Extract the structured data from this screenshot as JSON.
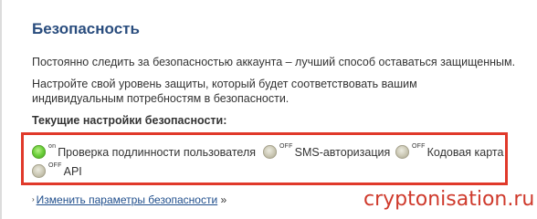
{
  "page_title": "Безопасность",
  "intro_text": "Постоянно следить за безопасностью аккаунта – лучший способ оставаться защищенным.",
  "setup_text": "Настройте свой уровень защиты, который будет соответствовать вашим индивидуальным потребностям в безопасности.",
  "current_settings_heading": "Текущие настройки безопасности:",
  "settings": [
    {
      "state": "on",
      "label": "Проверка подлинности пользователя",
      "indicator_icon": "green-status-dot-icon"
    },
    {
      "state": "OFF",
      "label": "SMS-авторизация",
      "indicator_icon": "gray-status-dot-icon"
    },
    {
      "state": "OFF",
      "label": "Кодовая карта",
      "indicator_icon": "gray-status-dot-icon"
    },
    {
      "state": "OFF",
      "label": "API",
      "indicator_icon": "gray-status-dot-icon"
    }
  ],
  "change_link": {
    "arrow": "›",
    "label": "Изменить параметры безопасности",
    "suffix": "»"
  },
  "watermark": "cryptonisation.ru",
  "colors": {
    "title": "#2a4d7e",
    "highlight_border": "#e0392a",
    "link": "#1f4e8c",
    "watermark": "#cf3a2c",
    "status_on": "#6bcf3a",
    "status_off": "#c9c6b2"
  }
}
